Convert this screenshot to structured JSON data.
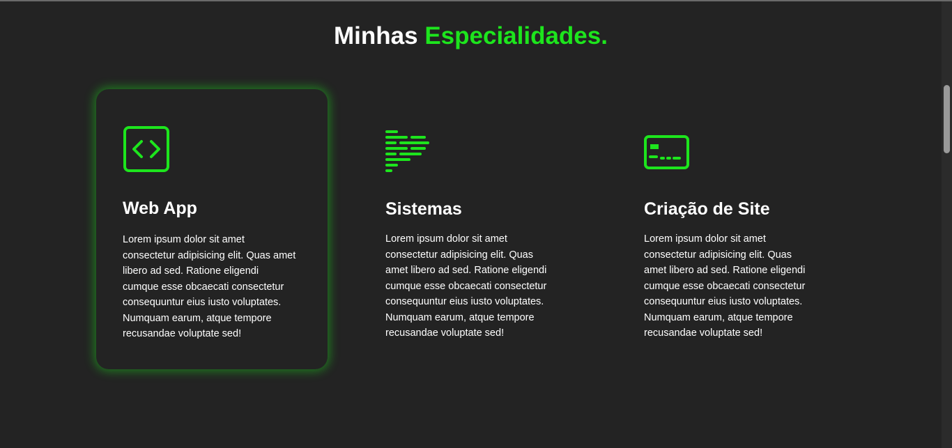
{
  "section": {
    "title_main": "Minhas",
    "title_accent": "Especialidades."
  },
  "colors": {
    "accent": "#1de51d",
    "background": "#232323",
    "text": "#ffffff"
  },
  "cards": [
    {
      "icon": "code-brackets-icon",
      "title": "Web App",
      "text": "Lorem ipsum dolor sit amet consectetur adipisicing elit. Quas amet libero ad sed. Ratione eligendi cumque esse obcaecati consectetur consequuntur eius iusto voluptates. Numquam earum, atque tempore recusandae voluptate sed!"
    },
    {
      "icon": "code-lines-icon",
      "title": "Sistemas",
      "text": "Lorem ipsum dolor sit amet consectetur adipisicing elit. Quas amet libero ad sed. Ratione eligendi cumque esse obcaecati consectetur consequuntur eius iusto voluptates. Numquam earum, atque tempore recusandae voluptate sed!"
    },
    {
      "icon": "terminal-window-icon",
      "title": "Criação de Site",
      "text": "Lorem ipsum dolor sit amet consectetur adipisicing elit. Quas amet libero ad sed. Ratione eligendi cumque esse obcaecati consectetur consequuntur eius iusto voluptates. Numquam earum, atque tempore recusandae voluptate sed!"
    }
  ]
}
